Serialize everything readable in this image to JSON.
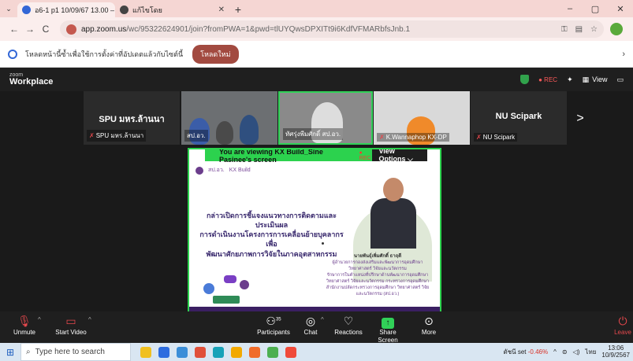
{
  "browser": {
    "tabs": [
      {
        "title": "อ6-1 p1 10/09/67 13.00 – 1",
        "active": true,
        "favicon_color": "#3367d6"
      },
      {
        "title": "แก้ไขโดย",
        "active": false,
        "favicon_color": "#444444"
      }
    ],
    "window_controls": {
      "minimize": "–",
      "maximize": "▢",
      "close": "✕"
    },
    "nav": {
      "back": "←",
      "forward": "→",
      "reload": "C"
    },
    "url_host": "app.zoom.us",
    "url_path": "/wc/95322624901/join?fromPWA=1&pwd=tlUYQwsDPXITt9i6KdfVFMARbfsJnb.1",
    "infobar": {
      "text": "โหลดหน้านี้ซ้ำเพื่อใช้การตั้งค่าที่อัปเดตแล้วกับไซต์นี้",
      "button": "โหลดใหม่"
    }
  },
  "zoom": {
    "logo_top": "zoom",
    "logo_bottom": "Workplace",
    "rec_label": "● REC",
    "view_label": "View",
    "tiles": [
      {
        "name": "SPU มหร.ล้านนา",
        "label": "SPU มหร.ล้านนา",
        "kind": "name"
      },
      {
        "name": "",
        "label": "สป.อว.",
        "kind": "video"
      },
      {
        "name": "",
        "label": "ทัศรุ่งพีมศักดิ์ สป.อว.",
        "kind": "video-active"
      },
      {
        "name": "",
        "label": "K.Wannaphop KX-DP",
        "kind": "video"
      },
      {
        "name": "NU Scipark",
        "label": "NU Scipark",
        "kind": "name"
      }
    ],
    "next_arrow": ">",
    "share_banner": {
      "text": "You are viewing  KX Build_Sine Pasinee's screen",
      "rec": "● REC",
      "view_options": "View Options ⌵"
    },
    "slide": {
      "logos": [
        "สป.อว.",
        "KX Build"
      ],
      "title_lines": [
        "กล่าวเปิดการชี้แจงแนวทางการติดตามและประเมินผล",
        "การดำเนินงานโครงการการเคลื่อนย้ายบุคลากรเพื่อ",
        "พัฒนาศักยภาพการวิจัยในภาคอุตสาหกรรม"
      ],
      "speaker_name": "นายพันธุ์เพิ่มศักดิ์ ธาฤดี",
      "speaker_lines": [
        "ผู้อำนวยการกองส่งเสริมและพัฒนาการอุดมศึกษา",
        "วิทยาศาสตร์ วิจัยและนวัตกรรม",
        "รักษาการในตำแหน่งที่ปรึกษาด้านพัฒนาการอุดมศึกษา",
        "วิทยาศาสตร์ วิจัยและนวัตกรรม กระทรวงการอุดมศึกษา",
        "สำนักงานปลัดกระทรวงการอุดมศึกษา วิทยาศาสตร์ วิจัย",
        "และนวัตกรรม (สป.อว.)"
      ]
    },
    "toolbar": {
      "unmute": "Unmute",
      "start_video": "Start Video",
      "participants": "Participants",
      "participants_count": "35",
      "chat": "Chat",
      "reactions": "Reactions",
      "share_screen": "Share Screen",
      "more": "More",
      "leave": "Leave"
    }
  },
  "taskbar": {
    "search_placeholder": "Type here to search",
    "stock_name": "ดัชนี set",
    "stock_change": "-0.46%",
    "lang": "ไทย",
    "time": "13:06",
    "date": "10/9/2567",
    "app_colors": [
      "#f0c020",
      "#2d6cdf",
      "#3b8ed8",
      "#e0503a",
      "#17a2b8",
      "#f2a900",
      "#f06c2b",
      "#4caf50",
      "#f04a3a"
    ]
  }
}
